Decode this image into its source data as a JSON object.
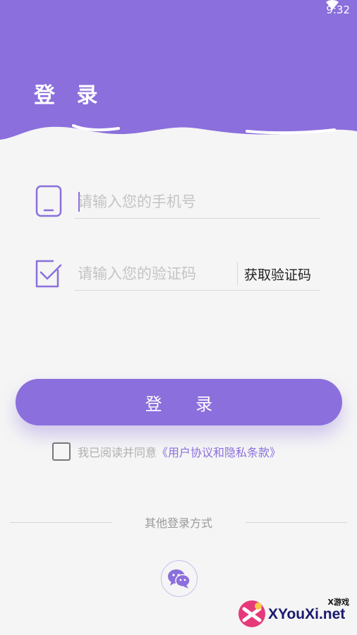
{
  "status_bar": {
    "time": "9:32",
    "wifi_icon": "wifi-icon"
  },
  "header": {
    "title": "登 录"
  },
  "form": {
    "phone": {
      "placeholder": "请输入您的手机号",
      "icon": "phone-icon"
    },
    "code": {
      "placeholder": "请输入您的验证码",
      "icon": "checkbox-icon",
      "get_code_label": "获取验证码"
    },
    "login_label": "登 录"
  },
  "agreement": {
    "checked": false,
    "text": "我已阅读并同意",
    "link": "《用户协议和隐私条款》"
  },
  "other_login": {
    "label": "其他登录方式",
    "wechat_icon": "wechat-icon"
  },
  "watermark": {
    "brand": "XYouXi.net",
    "sub": "X游戏"
  },
  "colors": {
    "accent": "#8b6fdc",
    "background": "#f5f5f5"
  }
}
